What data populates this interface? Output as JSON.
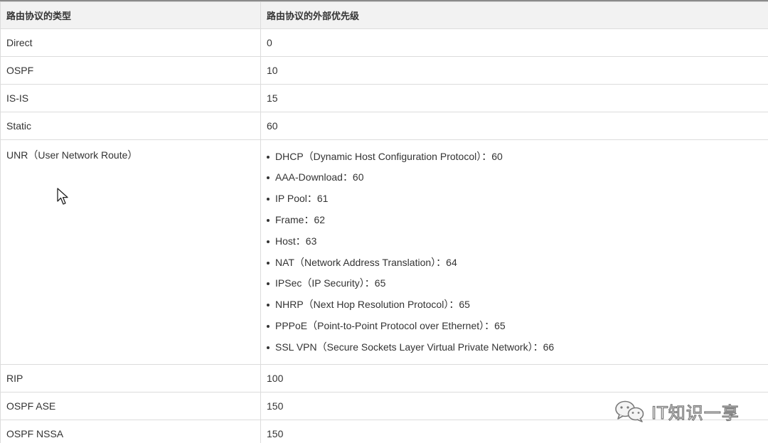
{
  "table": {
    "headers": [
      "路由协议的类型",
      "路由协议的外部优先级"
    ],
    "rows_top": [
      {
        "type": "Direct",
        "priority": "0"
      },
      {
        "type": "OSPF",
        "priority": "10"
      },
      {
        "type": "IS-IS",
        "priority": "15"
      },
      {
        "type": "Static",
        "priority": "60"
      }
    ],
    "unr": {
      "type": "UNR（User Network Route）",
      "items": [
        "DHCP（Dynamic Host Configuration Protocol）：60",
        "AAA-Download：60",
        "IP Pool：61",
        "Frame：62",
        "Host：63",
        "NAT（Network Address Translation）：64",
        "IPSec（IP Security）：65",
        "NHRP（Next Hop Resolution Protocol）：65",
        "PPPoE（Point-to-Point Protocol over Ethernet）：65",
        "SSL VPN（Secure Sockets Layer Virtual Private Network）：66"
      ]
    },
    "rows_bottom": [
      {
        "type": "RIP",
        "priority": "100"
      },
      {
        "type": "OSPF ASE",
        "priority": "150"
      },
      {
        "type": "OSPF NSSA",
        "priority": "150"
      }
    ]
  },
  "watermark": {
    "text": "IT知识一享",
    "icon": "wechat-icon"
  },
  "cursor": {
    "icon": "mouse-pointer-icon"
  }
}
